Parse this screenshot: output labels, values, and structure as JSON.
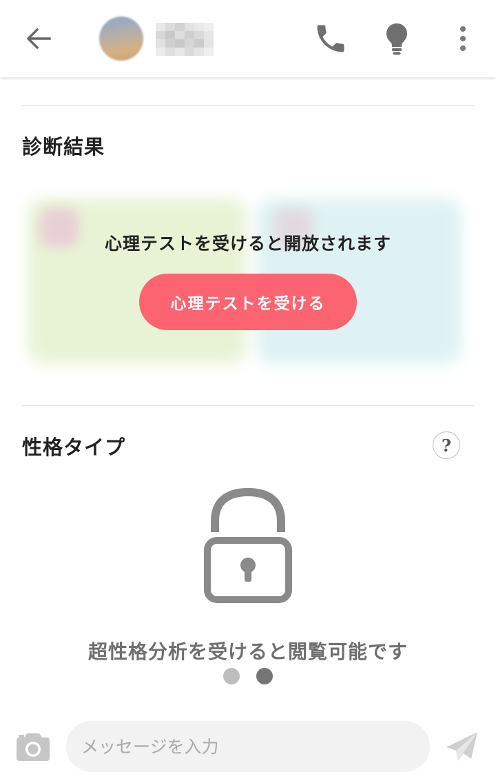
{
  "header": {
    "contact_name_hidden": true
  },
  "diagnosis": {
    "title": "診断結果",
    "unlock_message": "心理テストを受けると開放されます",
    "button_label": "心理テストを受ける"
  },
  "personality": {
    "title": "性格タイプ",
    "help_label": "?",
    "locked_message": "超性格分析を受けると閲覧可能です",
    "pager": {
      "total": 2,
      "active": 2
    }
  },
  "composer": {
    "placeholder": "メッセージを入力"
  },
  "icons": {
    "back": "arrow-left-icon",
    "phone": "phone-icon",
    "tips": "lightbulb-icon",
    "menu": "more-vertical-icon",
    "lock": "lock-icon",
    "camera": "camera-icon",
    "send": "send-icon"
  },
  "colors": {
    "accent": "#fb6470",
    "icon_gray": "#757575",
    "lock_gray": "#8a8a8a"
  }
}
